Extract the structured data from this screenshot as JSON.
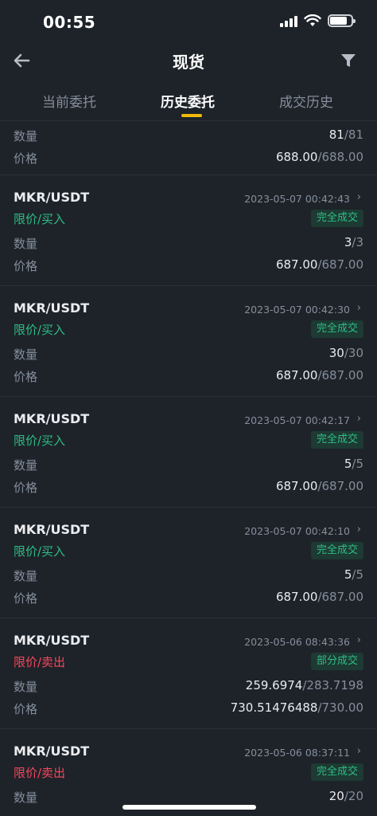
{
  "status_bar": {
    "time": "00:55",
    "battery_level": 0.8
  },
  "header": {
    "title": "现货",
    "back_icon": "arrow-left-icon",
    "filter_icon": "funnel-icon"
  },
  "tabs": [
    {
      "label": "当前委托",
      "active": false
    },
    {
      "label": "历史委托",
      "active": true
    },
    {
      "label": "成交历史",
      "active": false
    }
  ],
  "labels": {
    "qty": "数量",
    "price": "价格"
  },
  "colors": {
    "background": "#1e2329",
    "buy": "#2ebd85",
    "sell": "#f6465d",
    "accent": "#f0b90b",
    "muted": "#848e9c"
  },
  "orders": [
    {
      "qty_filled": "81",
      "qty_total": "/81",
      "price_filled": "688.00",
      "price_total": "/688.00"
    },
    {
      "pair": "MKR/USDT",
      "time": "2023-05-07 00:42:43",
      "type": "限价/买入",
      "status": "完全成交",
      "qty_filled": "3",
      "qty_total": "/3",
      "price_filled": "687.00",
      "price_total": "/687.00"
    },
    {
      "pair": "MKR/USDT",
      "time": "2023-05-07 00:42:30",
      "type": "限价/买入",
      "status": "完全成交",
      "qty_filled": "30",
      "qty_total": "/30",
      "price_filled": "687.00",
      "price_total": "/687.00"
    },
    {
      "pair": "MKR/USDT",
      "time": "2023-05-07 00:42:17",
      "type": "限价/买入",
      "status": "完全成交",
      "qty_filled": "5",
      "qty_total": "/5",
      "price_filled": "687.00",
      "price_total": "/687.00"
    },
    {
      "pair": "MKR/USDT",
      "time": "2023-05-07 00:42:10",
      "type": "限价/买入",
      "status": "完全成交",
      "qty_filled": "5",
      "qty_total": "/5",
      "price_filled": "687.00",
      "price_total": "/687.00"
    },
    {
      "pair": "MKR/USDT",
      "time": "2023-05-06 08:43:36",
      "type": "限价/卖出",
      "status": "部分成交",
      "qty_filled": "259.6974",
      "qty_total": "/283.7198",
      "price_filled": "730.51476488",
      "price_total": "/730.00"
    },
    {
      "pair": "MKR/USDT",
      "time": "2023-05-06 08:37:11",
      "type": "限价/卖出",
      "status": "完全成交",
      "qty_filled": "20",
      "qty_total": "/20"
    }
  ]
}
